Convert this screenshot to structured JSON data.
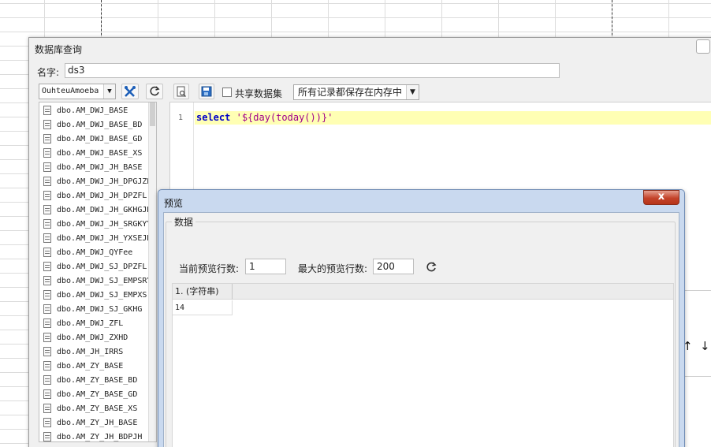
{
  "db_dialog": {
    "title": "数据库查询",
    "name_label": "名字:",
    "name_value": "ds3",
    "connection": "OuhteuAmoeba",
    "tables": [
      "dbo.AM_DWJ_BASE",
      "dbo.AM_DWJ_BASE_BD",
      "dbo.AM_DWJ_BASE_GD",
      "dbo.AM_DWJ_BASE_XS",
      "dbo.AM_DWJ_JH_BASE",
      "dbo.AM_DWJ_JH_DPGJZB",
      "dbo.AM_DWJ_JH_DPZFL",
      "dbo.AM_DWJ_JH_GKHGJH",
      "dbo.AM_DWJ_JH_SRGKYYJ",
      "dbo.AM_DWJ_JH_YXSEJH",
      "dbo.AM_DWJ_QYFee",
      "dbo.AM_DWJ_SJ_DPZFL",
      "dbo.AM_DWJ_SJ_EMPSRYY",
      "dbo.AM_DWJ_SJ_EMPXS",
      "dbo.AM_DWJ_SJ_GKHG",
      "dbo.AM_DWJ_ZFL",
      "dbo.AM_DWJ_ZXHD",
      "dbo.AM_JH_IRRS",
      "dbo.AM_ZY_BASE",
      "dbo.AM_ZY_BASE_BD",
      "dbo.AM_ZY_BASE_GD",
      "dbo.AM_ZY_BASE_XS",
      "dbo.AM_ZY_JH_BASE",
      "dbo.AM_ZY_JH_BDPJH"
    ],
    "share_dataset_label": "共享数据集",
    "memory_option": "所有记录都保存在内存中",
    "line_number": "1",
    "sql_keyword": "select",
    "sql_string": "'${day(today())}'"
  },
  "preview": {
    "title": "预览",
    "close_symbol": "x",
    "group_label": "数据",
    "current_rows_label": "当前预览行数:",
    "current_rows_value": "1",
    "max_rows_label": "最大的预览行数:",
    "max_rows_value": "200",
    "column_header": "1. (字符串)",
    "cell_value": "14"
  }
}
